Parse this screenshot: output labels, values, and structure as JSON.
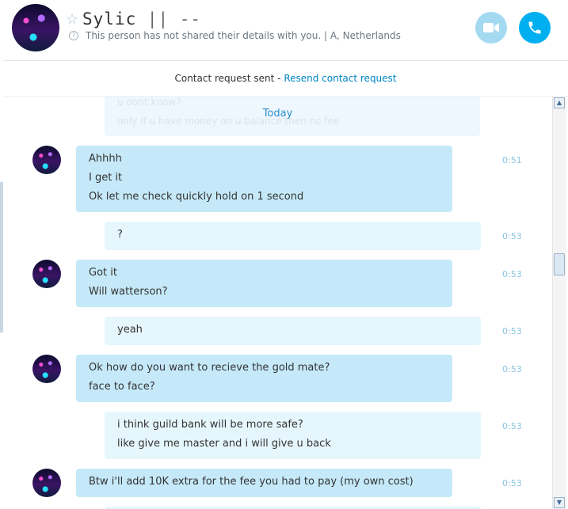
{
  "header": {
    "name": "Sylic",
    "name_suffix": " || --",
    "details": "This person has not shared their details with you.  |  A, Netherlands",
    "icons": {
      "favorite": "star-outline-icon",
      "info": "info-icon",
      "video": "video-camera-icon",
      "call": "phone-icon"
    },
    "colors": {
      "video_button": "#a3daf1",
      "call_button": "#00aff0"
    }
  },
  "request_bar": {
    "text": "Contact request sent - ",
    "link": "Resend contact request"
  },
  "chat": {
    "ghost_lines": [
      "u dont know?",
      "only if u have money on u balance then no fee"
    ],
    "date_separator": "Today",
    "messages": [
      {
        "direction": "in",
        "lines": [
          "Ahhhh",
          "I get it",
          "Ok let me check quickly hold on 1 second"
        ],
        "time": "0:51"
      },
      {
        "direction": "out",
        "lines": [
          "?"
        ],
        "time": "0:53"
      },
      {
        "direction": "in",
        "lines": [
          "Got it",
          "Will watterson?"
        ],
        "time": "0:53"
      },
      {
        "direction": "out",
        "lines": [
          "yeah"
        ],
        "time": "0:53"
      },
      {
        "direction": "in",
        "lines": [
          "Ok how do you want to recieve the gold mate?",
          "face to face?"
        ],
        "time": "0:53"
      },
      {
        "direction": "out",
        "lines": [
          "i think guild bank will be more safe?",
          "like give me master and i will give u back"
        ],
        "time": "0:53"
      },
      {
        "direction": "in",
        "lines": [
          "Btw i'll add 10K extra for the fee you had to pay (my own cost)"
        ],
        "time": "0:53"
      }
    ]
  },
  "scrollbar": {
    "up": "▲",
    "down": "▼"
  }
}
